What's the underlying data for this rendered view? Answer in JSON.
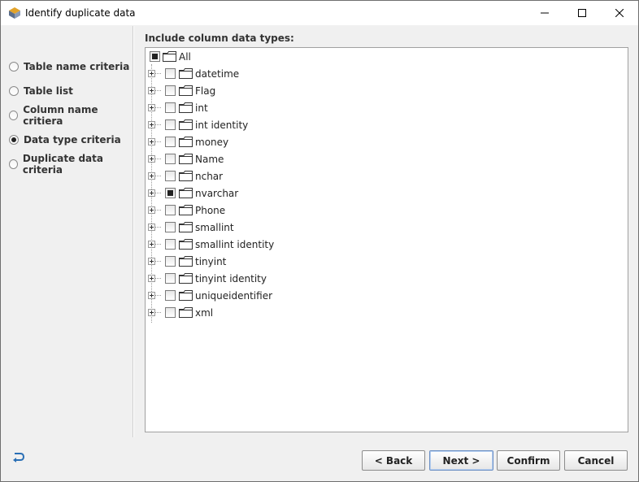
{
  "window": {
    "title": "Identify duplicate data",
    "controls": [
      "minimize-icon",
      "maximize-icon",
      "close-icon"
    ]
  },
  "left_panel": {
    "options": [
      {
        "label": "Table name criteria",
        "selected": false
      },
      {
        "label": "Table list",
        "selected": false
      },
      {
        "label": "Column name critiera",
        "selected": false
      },
      {
        "label": "Data type criteria",
        "selected": true
      },
      {
        "label": "Duplicate data criteria",
        "selected": false
      }
    ]
  },
  "main": {
    "heading": "Include column data types:",
    "root": {
      "label": "All",
      "state": "partial"
    },
    "items": [
      {
        "label": "datetime",
        "state": "unchecked"
      },
      {
        "label": "Flag",
        "state": "unchecked"
      },
      {
        "label": "int",
        "state": "unchecked"
      },
      {
        "label": "int identity",
        "state": "unchecked"
      },
      {
        "label": "money",
        "state": "unchecked"
      },
      {
        "label": "Name",
        "state": "unchecked"
      },
      {
        "label": "nchar",
        "state": "unchecked"
      },
      {
        "label": "nvarchar",
        "state": "partial"
      },
      {
        "label": "Phone",
        "state": "unchecked"
      },
      {
        "label": "smallint",
        "state": "unchecked"
      },
      {
        "label": "smallint identity",
        "state": "unchecked"
      },
      {
        "label": "tinyint",
        "state": "unchecked"
      },
      {
        "label": "tinyint identity",
        "state": "unchecked"
      },
      {
        "label": "uniqueidentifier",
        "state": "unchecked"
      },
      {
        "label": "xml",
        "state": "unchecked"
      }
    ]
  },
  "footer": {
    "icon": "undo-arrow-icon",
    "buttons": {
      "back": "< Back",
      "next": "Next >",
      "confirm": "Confirm",
      "cancel": "Cancel"
    }
  },
  "colors": {
    "window_bg": "#f0f0f0",
    "tree_bg": "#ffffff",
    "accent_focus": "#6b8fc4"
  }
}
